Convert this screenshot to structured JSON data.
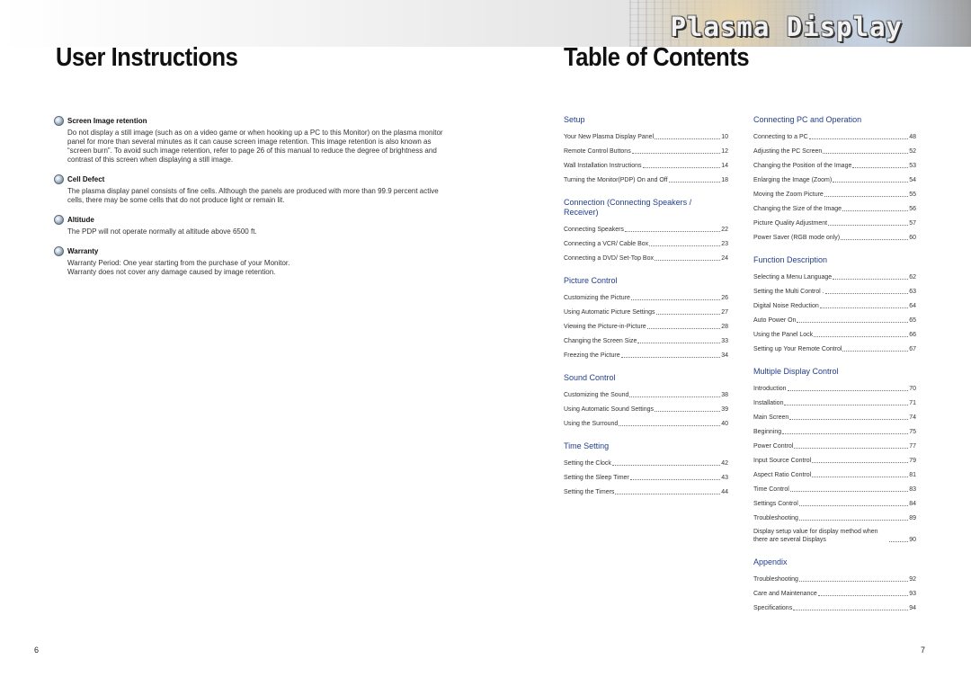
{
  "banner": {
    "title": "Plasma Display"
  },
  "left_page": {
    "heading": "User Instructions",
    "page_number": "6",
    "notes": [
      {
        "title": "Screen Image retention",
        "body": [
          "Do not display a still image (such as on a video game or when hooking up a PC to this Monitor) on the plasma monitor panel for more than several minutes as it can cause screen image retention. This image retention is also known as “screen burn”. To avoid such image retention, refer to page 26 of this manual to reduce the degree of brightness and contrast of this screen when displaying a still image."
        ]
      },
      {
        "title": "Cell Defect",
        "body": [
          "The plasma display panel consists of fine cells. Although the panels are produced with more than 99.9 percent active cells, there may be some cells that do not produce light or remain lit."
        ]
      },
      {
        "title": "Altitude",
        "body": [
          "The PDP will not operate normally at altitude above 6500 ft."
        ]
      },
      {
        "title": "Warranty",
        "body": [
          "Warranty Period: One year starting from the purchase of your Monitor.",
          "Warranty does not cover any damage caused by image retention."
        ]
      }
    ]
  },
  "right_page": {
    "heading": "Table of Contents",
    "page_number": "7",
    "columns": [
      [
        {
          "title": "Setup",
          "entries": [
            {
              "label": "Your New Plasma Display Panel",
              "page": "10"
            },
            {
              "label": "Remote Control Buttons",
              "page": "12"
            },
            {
              "label": "Wall Installation Instructions",
              "page": "14"
            },
            {
              "label": "Turning the Monitor(PDP) On and Off",
              "page": "18"
            }
          ]
        },
        {
          "title": "Connection (Connecting Speakers / Receiver)",
          "entries": [
            {
              "label": "Connecting Speakers",
              "page": "22"
            },
            {
              "label": "Connecting a VCR/ Cable Box",
              "page": "23"
            },
            {
              "label": "Connecting a DVD/ Set-Top Box",
              "page": "24"
            }
          ]
        },
        {
          "title": "Picture Control",
          "entries": [
            {
              "label": "Customizing the Picture",
              "page": "26"
            },
            {
              "label": "Using Automatic Picture Settings",
              "page": "27"
            },
            {
              "label": "Viewing the Picture-in-Picture",
              "page": "28"
            },
            {
              "label": "Changing the Screen Size",
              "page": "33"
            },
            {
              "label": "Freezing the Picture",
              "page": "34"
            }
          ]
        },
        {
          "title": "Sound Control",
          "entries": [
            {
              "label": "Customizing the Sound",
              "page": "38"
            },
            {
              "label": "Using Automatic Sound Settings",
              "page": "39"
            },
            {
              "label": "Using the Surround",
              "page": "40"
            }
          ]
        },
        {
          "title": "Time Setting",
          "entries": [
            {
              "label": "Setting the Clock",
              "page": "42"
            },
            {
              "label": "Setting the Sleep Timer",
              "page": "43"
            },
            {
              "label": "Setting the Timers",
              "page": "44"
            }
          ]
        }
      ],
      [
        {
          "title": "Connecting PC and Operation",
          "entries": [
            {
              "label": "Connecting to a PC",
              "page": "48"
            },
            {
              "label": "Adjusting the PC Screen",
              "page": "52"
            },
            {
              "label": "Changing the Position of the Image",
              "page": "53"
            },
            {
              "label": "Enlarging the Image (Zoom)",
              "page": "54"
            },
            {
              "label": "Moving the Zoom Picture",
              "page": "55"
            },
            {
              "label": "Changing the Size of the Image",
              "page": "56"
            },
            {
              "label": "Picture Quality Adjustment",
              "page": "57"
            },
            {
              "label": "Power Saver (RGB mode only)",
              "page": "60"
            }
          ]
        },
        {
          "title": "Function Description",
          "entries": [
            {
              "label": "Selecting a Menu Language",
              "page": "62"
            },
            {
              "label": "Setting the Multi Control .",
              "page": "63"
            },
            {
              "label": "Digital Noise Reduction",
              "page": "64"
            },
            {
              "label": "Auto Power On",
              "page": "65"
            },
            {
              "label": "Using the Panel Lock",
              "page": "66"
            },
            {
              "label": "Setting up Your Remote Control",
              "page": "67"
            }
          ]
        },
        {
          "title": "Multiple Display Control",
          "entries": [
            {
              "label": "Introduction",
              "page": "70"
            },
            {
              "label": "Installation",
              "page": "71"
            },
            {
              "label": "Main Screen",
              "page": "74"
            },
            {
              "label": "Beginning",
              "page": "75"
            },
            {
              "label": "Power Control",
              "page": "77"
            },
            {
              "label": "Input Source Control",
              "page": "79"
            },
            {
              "label": "Aspect Ratio Control",
              "page": "81"
            },
            {
              "label": "Time Control",
              "page": "83"
            },
            {
              "label": "Settings Control",
              "page": "84"
            },
            {
              "label": "Troubleshooting",
              "page": "89"
            },
            {
              "label": "Display setup value for display method when there are several Displays",
              "page": "90"
            }
          ]
        },
        {
          "title": "Appendix",
          "entries": [
            {
              "label": "Troubleshooting",
              "page": "92"
            },
            {
              "label": "Care and Maintenance",
              "page": "93"
            },
            {
              "label": "Specifications",
              "page": "94"
            }
          ]
        }
      ]
    ]
  }
}
